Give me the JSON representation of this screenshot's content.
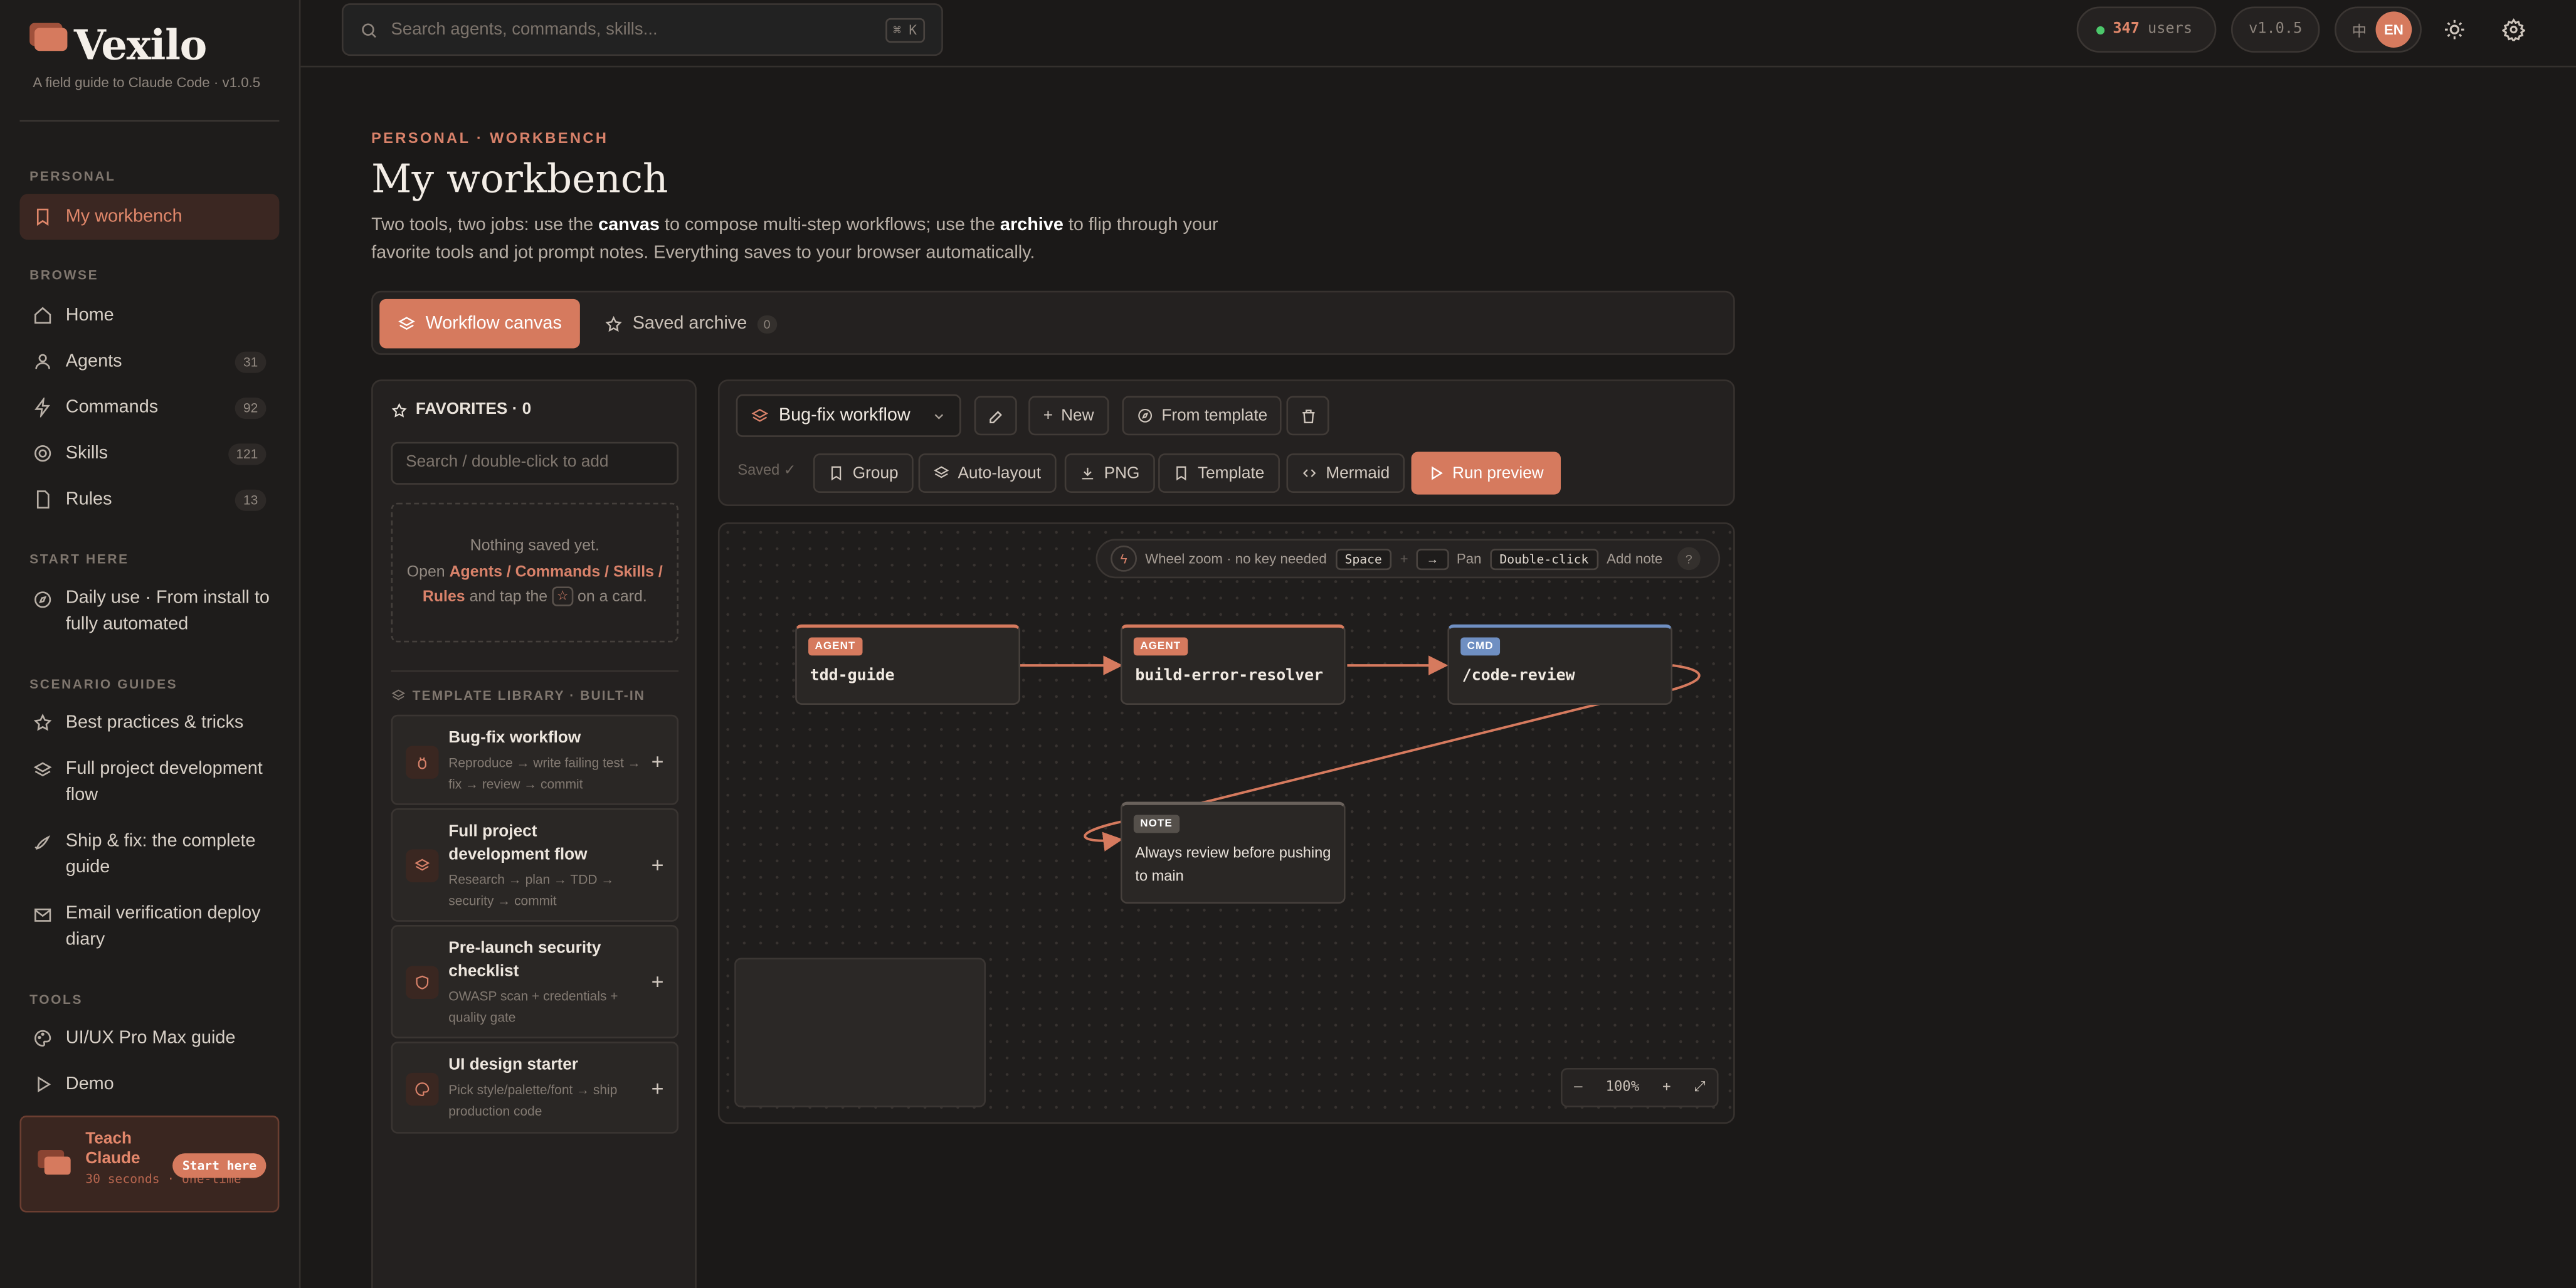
{
  "app": {
    "name": "Vexilo",
    "tagline": "A field guide to Claude Code · v1.0.5"
  },
  "colors": {
    "accent": "#d67a5e",
    "background": "#1b1918",
    "agent_tag": "#d67a5e",
    "cmd_tag": "#6f8fc2",
    "note_tag": "#55504b",
    "online": "#4cc76b"
  },
  "sidebar": {
    "personal_heading": "PERSONAL",
    "workbench_label": "My workbench",
    "browse_heading": "BROWSE",
    "browse_items": [
      {
        "label": "Home",
        "icon": "home-icon"
      },
      {
        "label": "Agents",
        "count": "31",
        "icon": "user-icon"
      },
      {
        "label": "Commands",
        "count": "92",
        "icon": "zap-icon"
      },
      {
        "label": "Skills",
        "count": "121",
        "icon": "target-icon"
      },
      {
        "label": "Rules",
        "count": "13",
        "icon": "file-icon"
      }
    ],
    "start_heading": "START HERE",
    "start_item": "Daily use · From install to fully automated",
    "scenario_heading": "SCENARIO GUIDES",
    "scenario_items": [
      {
        "label": "Best practices & tricks",
        "icon": "star-icon"
      },
      {
        "label": "Full project development flow",
        "icon": "layers-icon"
      },
      {
        "label": "Ship & fix: the complete guide",
        "icon": "rocket-icon"
      },
      {
        "label": "Email verification deploy diary",
        "icon": "mail-icon"
      }
    ],
    "tools_heading": "TOOLS",
    "tools_items": [
      {
        "label": "UI/UX Pro Max guide",
        "icon": "palette-icon"
      },
      {
        "label": "Demo",
        "icon": "play-icon"
      }
    ],
    "teach": {
      "title": "Teach Claude",
      "subtitle": "30 seconds · one-time",
      "button": "Start here"
    }
  },
  "topbar": {
    "search_placeholder": "Search agents, commands, skills...",
    "shortcut": "⌘ K",
    "users_count": "347",
    "users_label": "users",
    "version": "v1.0.5",
    "lang_zh": "中",
    "lang_en": "EN"
  },
  "page": {
    "eyebrow": "PERSONAL · WORKBENCH",
    "title": "My workbench",
    "desc_1": "Two tools, two jobs: use the ",
    "desc_canvas": "canvas",
    "desc_2": " to compose multi-step workflows; use the ",
    "desc_archive": "archive",
    "desc_3": " to flip through your favorite tools and jot prompt notes. Everything saves to your browser automatically."
  },
  "tabs": {
    "canvas_label": "Workflow canvas",
    "archive_label": "Saved archive",
    "archive_count": "0"
  },
  "favorites": {
    "heading": "FAVORITES · 0",
    "search_placeholder": "Search / double-click to add",
    "empty_title": "Nothing saved yet.",
    "empty_open": "Open ",
    "empty_links": "Agents / Commands / Skills / Rules",
    "empty_tap": " and tap the ",
    "empty_end": " on a card.",
    "library_heading": "TEMPLATE LIBRARY · BUILT-IN",
    "templates": [
      {
        "title": "Bug-fix workflow",
        "desc": "Reproduce → write failing test → fix → review → commit",
        "icon": "bug-icon"
      },
      {
        "title": "Full project development flow",
        "desc": "Research → plan → TDD → security → commit",
        "icon": "layers-icon"
      },
      {
        "title": "Pre-launch security checklist",
        "desc": "OWASP scan + credentials + quality gate",
        "icon": "shield-icon"
      },
      {
        "title": "UI design starter",
        "desc": "Pick style/palette/font → ship production code",
        "icon": "palette-icon"
      }
    ]
  },
  "toolbar": {
    "workflow_name": "Bug-fix workflow",
    "new_label": "New",
    "from_template_label": "From template",
    "saved_label": "Saved ✓",
    "group_label": "Group",
    "autolayout_label": "Auto-layout",
    "png_label": "PNG",
    "template_label": "Template",
    "mermaid_label": "Mermaid",
    "run_label": "Run preview"
  },
  "canvas": {
    "hint_zoom": "Wheel zoom · no key needed",
    "hint_space": "Space",
    "hint_plus": "+",
    "hint_arrow": "→",
    "hint_pan": "Pan",
    "hint_dbl": "Double-click",
    "hint_add": "Add note",
    "hint_help": "?",
    "nodes": [
      {
        "tag": "AGENT",
        "label": "tdd-guide"
      },
      {
        "tag": "AGENT",
        "label": "build-error-resolver"
      },
      {
        "tag": "CMD",
        "label": "/code-review"
      }
    ],
    "note": {
      "tag": "NOTE",
      "text": "Always review before pushing to main"
    },
    "zoom": {
      "minus": "–",
      "level": "100%",
      "plus": "+",
      "fit": "⤢"
    }
  }
}
